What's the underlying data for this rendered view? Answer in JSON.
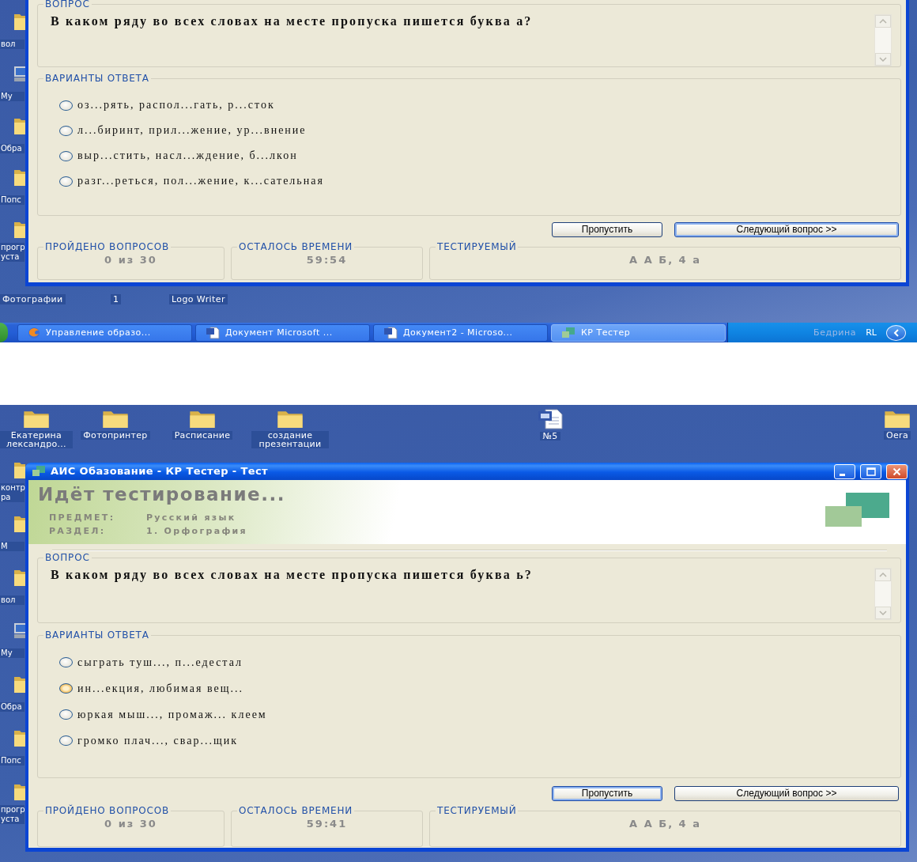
{
  "screens": [
    {
      "left_icons": [
        {
          "label": "вол",
          "kind": "folder"
        },
        {
          "label": "My",
          "kind": "computer"
        },
        {
          "label": "Обра",
          "kind": "folder"
        },
        {
          "label": "Попс",
          "kind": "folder"
        },
        {
          "label": "прогр уста",
          "kind": "folder"
        }
      ],
      "bottom_icons": [
        {
          "label": "Фотографии"
        },
        {
          "label": "1"
        },
        {
          "label": "Logo Writer"
        }
      ],
      "window": {
        "question": {
          "legend": "ВОПРОС",
          "text": "В каком ряду во всех словах на месте пропуска пишется буква а?"
        },
        "answers": {
          "legend": "ВАРИАНТЫ ОТВЕТА",
          "options": [
            {
              "text": "оз...рять, распол...гать, р...сток",
              "selected": false,
              "highlighted": false
            },
            {
              "text": "л...биринт, прил...жение, ур...внение",
              "selected": false,
              "highlighted": false
            },
            {
              "text": "выр...стить, насл...ждение, б...лкон",
              "selected": false,
              "highlighted": false
            },
            {
              "text": "разг...реться, пол...жение, к...сательная",
              "selected": false,
              "highlighted": false
            }
          ]
        },
        "buttons": [
          {
            "label": "Пропустить",
            "focused": false
          },
          {
            "label": "Следующий вопрос >>",
            "focused": true
          }
        ],
        "status": [
          {
            "legend": "ПРОЙДЕНО ВОПРОСОВ",
            "value": "0 из 30"
          },
          {
            "legend": "ОСТАЛОСЬ ВРЕМЕНИ",
            "value": "59:54"
          },
          {
            "legend": "ТЕСТИРУЕМЫЙ",
            "value": "А А Б, 4 а"
          }
        ]
      },
      "taskbar": {
        "tasks": [
          {
            "label": "Управление образо...",
            "kind": "browser",
            "selected": false
          },
          {
            "label": "Документ Microsoft ...",
            "kind": "word",
            "selected": false
          },
          {
            "label": "Документ2 - Microso...",
            "kind": "word",
            "selected": false
          },
          {
            "label": "КР Тестер",
            "kind": "app",
            "selected": true
          }
        ],
        "tray": {
          "user": "Бедрина",
          "language": "RL"
        }
      }
    },
    {
      "top_icons": [
        {
          "label": "Екатерина лександро...",
          "kind": "folder"
        },
        {
          "label": "Фотопринтер",
          "kind": "folder"
        },
        {
          "label": "Расписание",
          "kind": "folder"
        },
        {
          "label": "создание презентации",
          "kind": "folder"
        },
        {
          "label": "№5",
          "kind": "word"
        },
        {
          "label": "Oera",
          "kind": "folder"
        }
      ],
      "left_icons": [
        {
          "label": "контр ра",
          "kind": "folder"
        },
        {
          "label": "М",
          "kind": "folder"
        },
        {
          "label": "вол",
          "kind": "folder"
        },
        {
          "label": "My",
          "kind": "computer"
        },
        {
          "label": "Обра",
          "kind": "folder"
        },
        {
          "label": "Попс",
          "kind": "folder"
        },
        {
          "label": "прогр уста",
          "kind": "folder"
        }
      ],
      "window": {
        "title": "АИС Обазование - КР Тестер - Тест",
        "header": {
          "heading": "Идёт тестирование...",
          "fields": [
            {
              "label": "ПРЕДМЕТ:",
              "value": "Русский язык"
            },
            {
              "label": "РАЗДЕЛ:",
              "value": "1. Орфография"
            }
          ]
        },
        "question": {
          "legend": "ВОПРОС",
          "text": "В каком ряду во всех словах на месте пропуска пишется буква ь?"
        },
        "answers": {
          "legend": "ВАРИАНТЫ ОТВЕТА",
          "options": [
            {
              "text": "сыграть туш..., п...едестал",
              "selected": false,
              "highlighted": false
            },
            {
              "text": "ин...екция, любимая вещ...",
              "selected": false,
              "highlighted": true
            },
            {
              "text": "юркая мыш..., промаж... клеем",
              "selected": false,
              "highlighted": false
            },
            {
              "text": "громко плач..., свар...щик",
              "selected": false,
              "highlighted": false
            }
          ]
        },
        "buttons": [
          {
            "label": "Пропустить",
            "focused": true
          },
          {
            "label": "Следующий вопрос >>",
            "focused": false
          }
        ],
        "status": [
          {
            "legend": "ПРОЙДЕНО ВОПРОСОВ",
            "value": "0 из 30"
          },
          {
            "legend": "ОСТАЛОСЬ ВРЕМЕНИ",
            "value": "59:41"
          },
          {
            "legend": "ТЕСТИРУЕМЫЙ",
            "value": "А А Б, 4 а"
          }
        ]
      }
    }
  ]
}
